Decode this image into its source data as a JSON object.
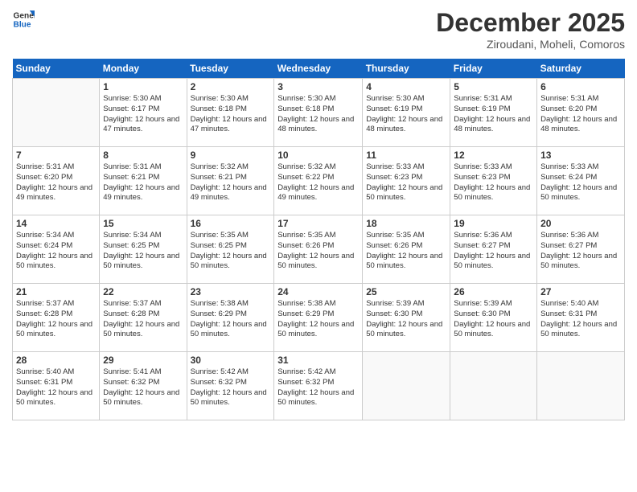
{
  "header": {
    "logo_line1": "General",
    "logo_line2": "Blue",
    "month_title": "December 2025",
    "location": "Ziroudani, Moheli, Comoros"
  },
  "days_of_week": [
    "Sunday",
    "Monday",
    "Tuesday",
    "Wednesday",
    "Thursday",
    "Friday",
    "Saturday"
  ],
  "weeks": [
    [
      {
        "day": "",
        "info": ""
      },
      {
        "day": "1",
        "info": "Sunrise: 5:30 AM\nSunset: 6:17 PM\nDaylight: 12 hours\nand 47 minutes."
      },
      {
        "day": "2",
        "info": "Sunrise: 5:30 AM\nSunset: 6:18 PM\nDaylight: 12 hours\nand 47 minutes."
      },
      {
        "day": "3",
        "info": "Sunrise: 5:30 AM\nSunset: 6:18 PM\nDaylight: 12 hours\nand 48 minutes."
      },
      {
        "day": "4",
        "info": "Sunrise: 5:30 AM\nSunset: 6:19 PM\nDaylight: 12 hours\nand 48 minutes."
      },
      {
        "day": "5",
        "info": "Sunrise: 5:31 AM\nSunset: 6:19 PM\nDaylight: 12 hours\nand 48 minutes."
      },
      {
        "day": "6",
        "info": "Sunrise: 5:31 AM\nSunset: 6:20 PM\nDaylight: 12 hours\nand 48 minutes."
      }
    ],
    [
      {
        "day": "7",
        "info": "Sunrise: 5:31 AM\nSunset: 6:20 PM\nDaylight: 12 hours\nand 49 minutes."
      },
      {
        "day": "8",
        "info": "Sunrise: 5:31 AM\nSunset: 6:21 PM\nDaylight: 12 hours\nand 49 minutes."
      },
      {
        "day": "9",
        "info": "Sunrise: 5:32 AM\nSunset: 6:21 PM\nDaylight: 12 hours\nand 49 minutes."
      },
      {
        "day": "10",
        "info": "Sunrise: 5:32 AM\nSunset: 6:22 PM\nDaylight: 12 hours\nand 49 minutes."
      },
      {
        "day": "11",
        "info": "Sunrise: 5:33 AM\nSunset: 6:23 PM\nDaylight: 12 hours\nand 50 minutes."
      },
      {
        "day": "12",
        "info": "Sunrise: 5:33 AM\nSunset: 6:23 PM\nDaylight: 12 hours\nand 50 minutes."
      },
      {
        "day": "13",
        "info": "Sunrise: 5:33 AM\nSunset: 6:24 PM\nDaylight: 12 hours\nand 50 minutes."
      }
    ],
    [
      {
        "day": "14",
        "info": "Sunrise: 5:34 AM\nSunset: 6:24 PM\nDaylight: 12 hours\nand 50 minutes."
      },
      {
        "day": "15",
        "info": "Sunrise: 5:34 AM\nSunset: 6:25 PM\nDaylight: 12 hours\nand 50 minutes."
      },
      {
        "day": "16",
        "info": "Sunrise: 5:35 AM\nSunset: 6:25 PM\nDaylight: 12 hours\nand 50 minutes."
      },
      {
        "day": "17",
        "info": "Sunrise: 5:35 AM\nSunset: 6:26 PM\nDaylight: 12 hours\nand 50 minutes."
      },
      {
        "day": "18",
        "info": "Sunrise: 5:35 AM\nSunset: 6:26 PM\nDaylight: 12 hours\nand 50 minutes."
      },
      {
        "day": "19",
        "info": "Sunrise: 5:36 AM\nSunset: 6:27 PM\nDaylight: 12 hours\nand 50 minutes."
      },
      {
        "day": "20",
        "info": "Sunrise: 5:36 AM\nSunset: 6:27 PM\nDaylight: 12 hours\nand 50 minutes."
      }
    ],
    [
      {
        "day": "21",
        "info": "Sunrise: 5:37 AM\nSunset: 6:28 PM\nDaylight: 12 hours\nand 50 minutes."
      },
      {
        "day": "22",
        "info": "Sunrise: 5:37 AM\nSunset: 6:28 PM\nDaylight: 12 hours\nand 50 minutes."
      },
      {
        "day": "23",
        "info": "Sunrise: 5:38 AM\nSunset: 6:29 PM\nDaylight: 12 hours\nand 50 minutes."
      },
      {
        "day": "24",
        "info": "Sunrise: 5:38 AM\nSunset: 6:29 PM\nDaylight: 12 hours\nand 50 minutes."
      },
      {
        "day": "25",
        "info": "Sunrise: 5:39 AM\nSunset: 6:30 PM\nDaylight: 12 hours\nand 50 minutes."
      },
      {
        "day": "26",
        "info": "Sunrise: 5:39 AM\nSunset: 6:30 PM\nDaylight: 12 hours\nand 50 minutes."
      },
      {
        "day": "27",
        "info": "Sunrise: 5:40 AM\nSunset: 6:31 PM\nDaylight: 12 hours\nand 50 minutes."
      }
    ],
    [
      {
        "day": "28",
        "info": "Sunrise: 5:40 AM\nSunset: 6:31 PM\nDaylight: 12 hours\nand 50 minutes."
      },
      {
        "day": "29",
        "info": "Sunrise: 5:41 AM\nSunset: 6:32 PM\nDaylight: 12 hours\nand 50 minutes."
      },
      {
        "day": "30",
        "info": "Sunrise: 5:42 AM\nSunset: 6:32 PM\nDaylight: 12 hours\nand 50 minutes."
      },
      {
        "day": "31",
        "info": "Sunrise: 5:42 AM\nSunset: 6:32 PM\nDaylight: 12 hours\nand 50 minutes."
      },
      {
        "day": "",
        "info": ""
      },
      {
        "day": "",
        "info": ""
      },
      {
        "day": "",
        "info": ""
      }
    ]
  ]
}
